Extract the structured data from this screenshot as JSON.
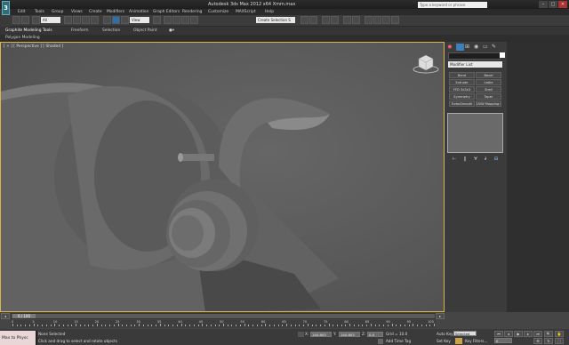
{
  "window": {
    "title": "Autodesk 3ds Max  2012 x64      Xmm.max",
    "search_placeholder": "Type a keyword or phrase",
    "logo_text": "3",
    "minimize": "–",
    "maximize": "□",
    "close": "✕"
  },
  "menubar": {
    "items": [
      "Edit",
      "Tools",
      "Group",
      "Views",
      "Create",
      "Modifiers",
      "Animation",
      "Graph Editors",
      "Rendering",
      "Customize",
      "MAXScript",
      "Help"
    ]
  },
  "toolbar": {
    "selection_filter": "All",
    "reference_coord": "View",
    "named_selection": "Create Selection S"
  },
  "ribbon": {
    "tabs": [
      "Graphite Modeling Tools",
      "Freeform",
      "Selection",
      "Object Paint"
    ],
    "subtitle": "Polygon Modeling"
  },
  "viewport": {
    "label": "[ + ] [ Perspective ] [ Shaded ]"
  },
  "command_panel": {
    "modifier_list": "Modifier List",
    "buttons": [
      "Bend",
      "Bevel",
      "Extrude",
      "Lathe",
      "FFD 3x3x3",
      "Shell",
      "Symmetry",
      "Taper",
      "TurboSmooth",
      "UVW Mapping Clr"
    ],
    "stack_icons": [
      "⊢",
      "‖",
      "∀",
      "∂",
      "⊟"
    ]
  },
  "timeline": {
    "frame_display": "0 / 100",
    "tick_labels": [
      "0",
      "5",
      "10",
      "15",
      "20",
      "25",
      "30",
      "35",
      "40",
      "45",
      "50",
      "55",
      "60",
      "65",
      "70",
      "75",
      "80",
      "85",
      "90",
      "95",
      "100"
    ]
  },
  "statusbar": {
    "maxscript_label": "Max to Physc",
    "selection_status": "None Selected",
    "prompt": "Click and drag to select and rotate objects",
    "x_label": "X:",
    "x_value": "140.803",
    "y_label": "Y:",
    "y_value": "140.803",
    "z_label": "Z:",
    "z_value": "0.0",
    "grid": "Grid = 10.0",
    "add_time_tag": "Add Time Tag",
    "auto_key": "Auto Key",
    "auto_key_mode": "Selected",
    "set_key": "Set Key",
    "key_filters": "Key Filters...",
    "frame": "0"
  }
}
